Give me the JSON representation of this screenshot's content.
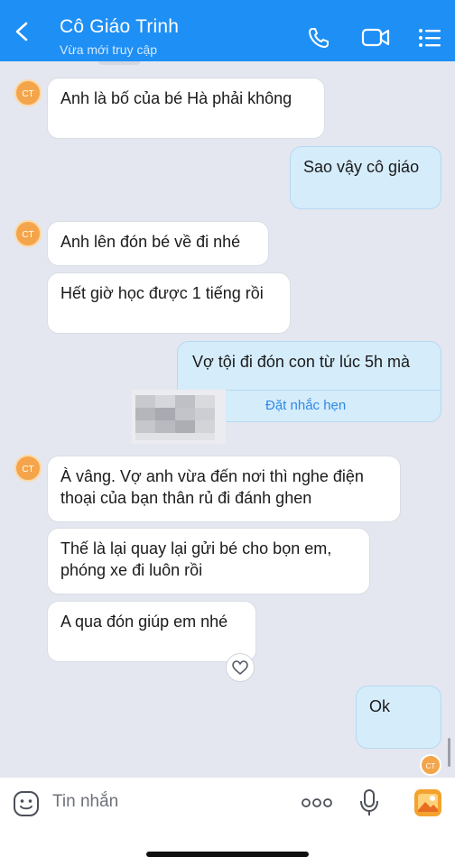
{
  "header": {
    "title": "Cô Giáo Trinh",
    "subtitle": "Vừa mới truy cập"
  },
  "avatar": {
    "initials": "CT",
    "color": "#f4a54b"
  },
  "messages": [
    {
      "side": "in",
      "lines": [
        "Anh là bố của bé Hà phải không"
      ]
    },
    {
      "side": "out",
      "lines": [
        "Sao vậy cô giáo"
      ]
    },
    {
      "side": "in",
      "lines": [
        "Anh lên đón bé về đi nhé"
      ]
    },
    {
      "side": "in",
      "lines": [
        "Hết giờ học được 1 tiếng rồi"
      ]
    },
    {
      "side": "out",
      "lines": [
        "Vợ tội đi đón con từ lúc 5h mà"
      ],
      "action": "Đặt nhắc hẹn"
    },
    {
      "side": "in",
      "lines": [
        "À vâng. Vợ anh vừa đến nơi thì nghe điện",
        "thoại của bạn thân rủ đi đánh ghen"
      ]
    },
    {
      "side": "in",
      "lines": [
        "Thế là lại quay lại gửi bé cho bọn em,",
        "phóng xe đi luôn rồi"
      ]
    },
    {
      "side": "in",
      "lines": [
        "A qua đón giúp em nhé"
      ]
    },
    {
      "side": "out",
      "lines": [
        "Ok"
      ]
    }
  ],
  "composer": {
    "placeholder": "Tin nhắn",
    "more_label": "ooo"
  },
  "icons": {
    "back": "chevron-left-icon",
    "call": "phone-icon",
    "video": "video-camera-icon",
    "menu": "list-menu-icon",
    "sticker": "sticker-face-icon",
    "mic": "microphone-icon",
    "image": "image-icon",
    "react": "heart-icon"
  },
  "colors": {
    "header": "#1e8ff5",
    "outgoing_bubble": "#d5ecfb",
    "incoming_bubble": "#ffffff",
    "chat_background": "#e4e7ef",
    "link": "#2f8ae6"
  }
}
